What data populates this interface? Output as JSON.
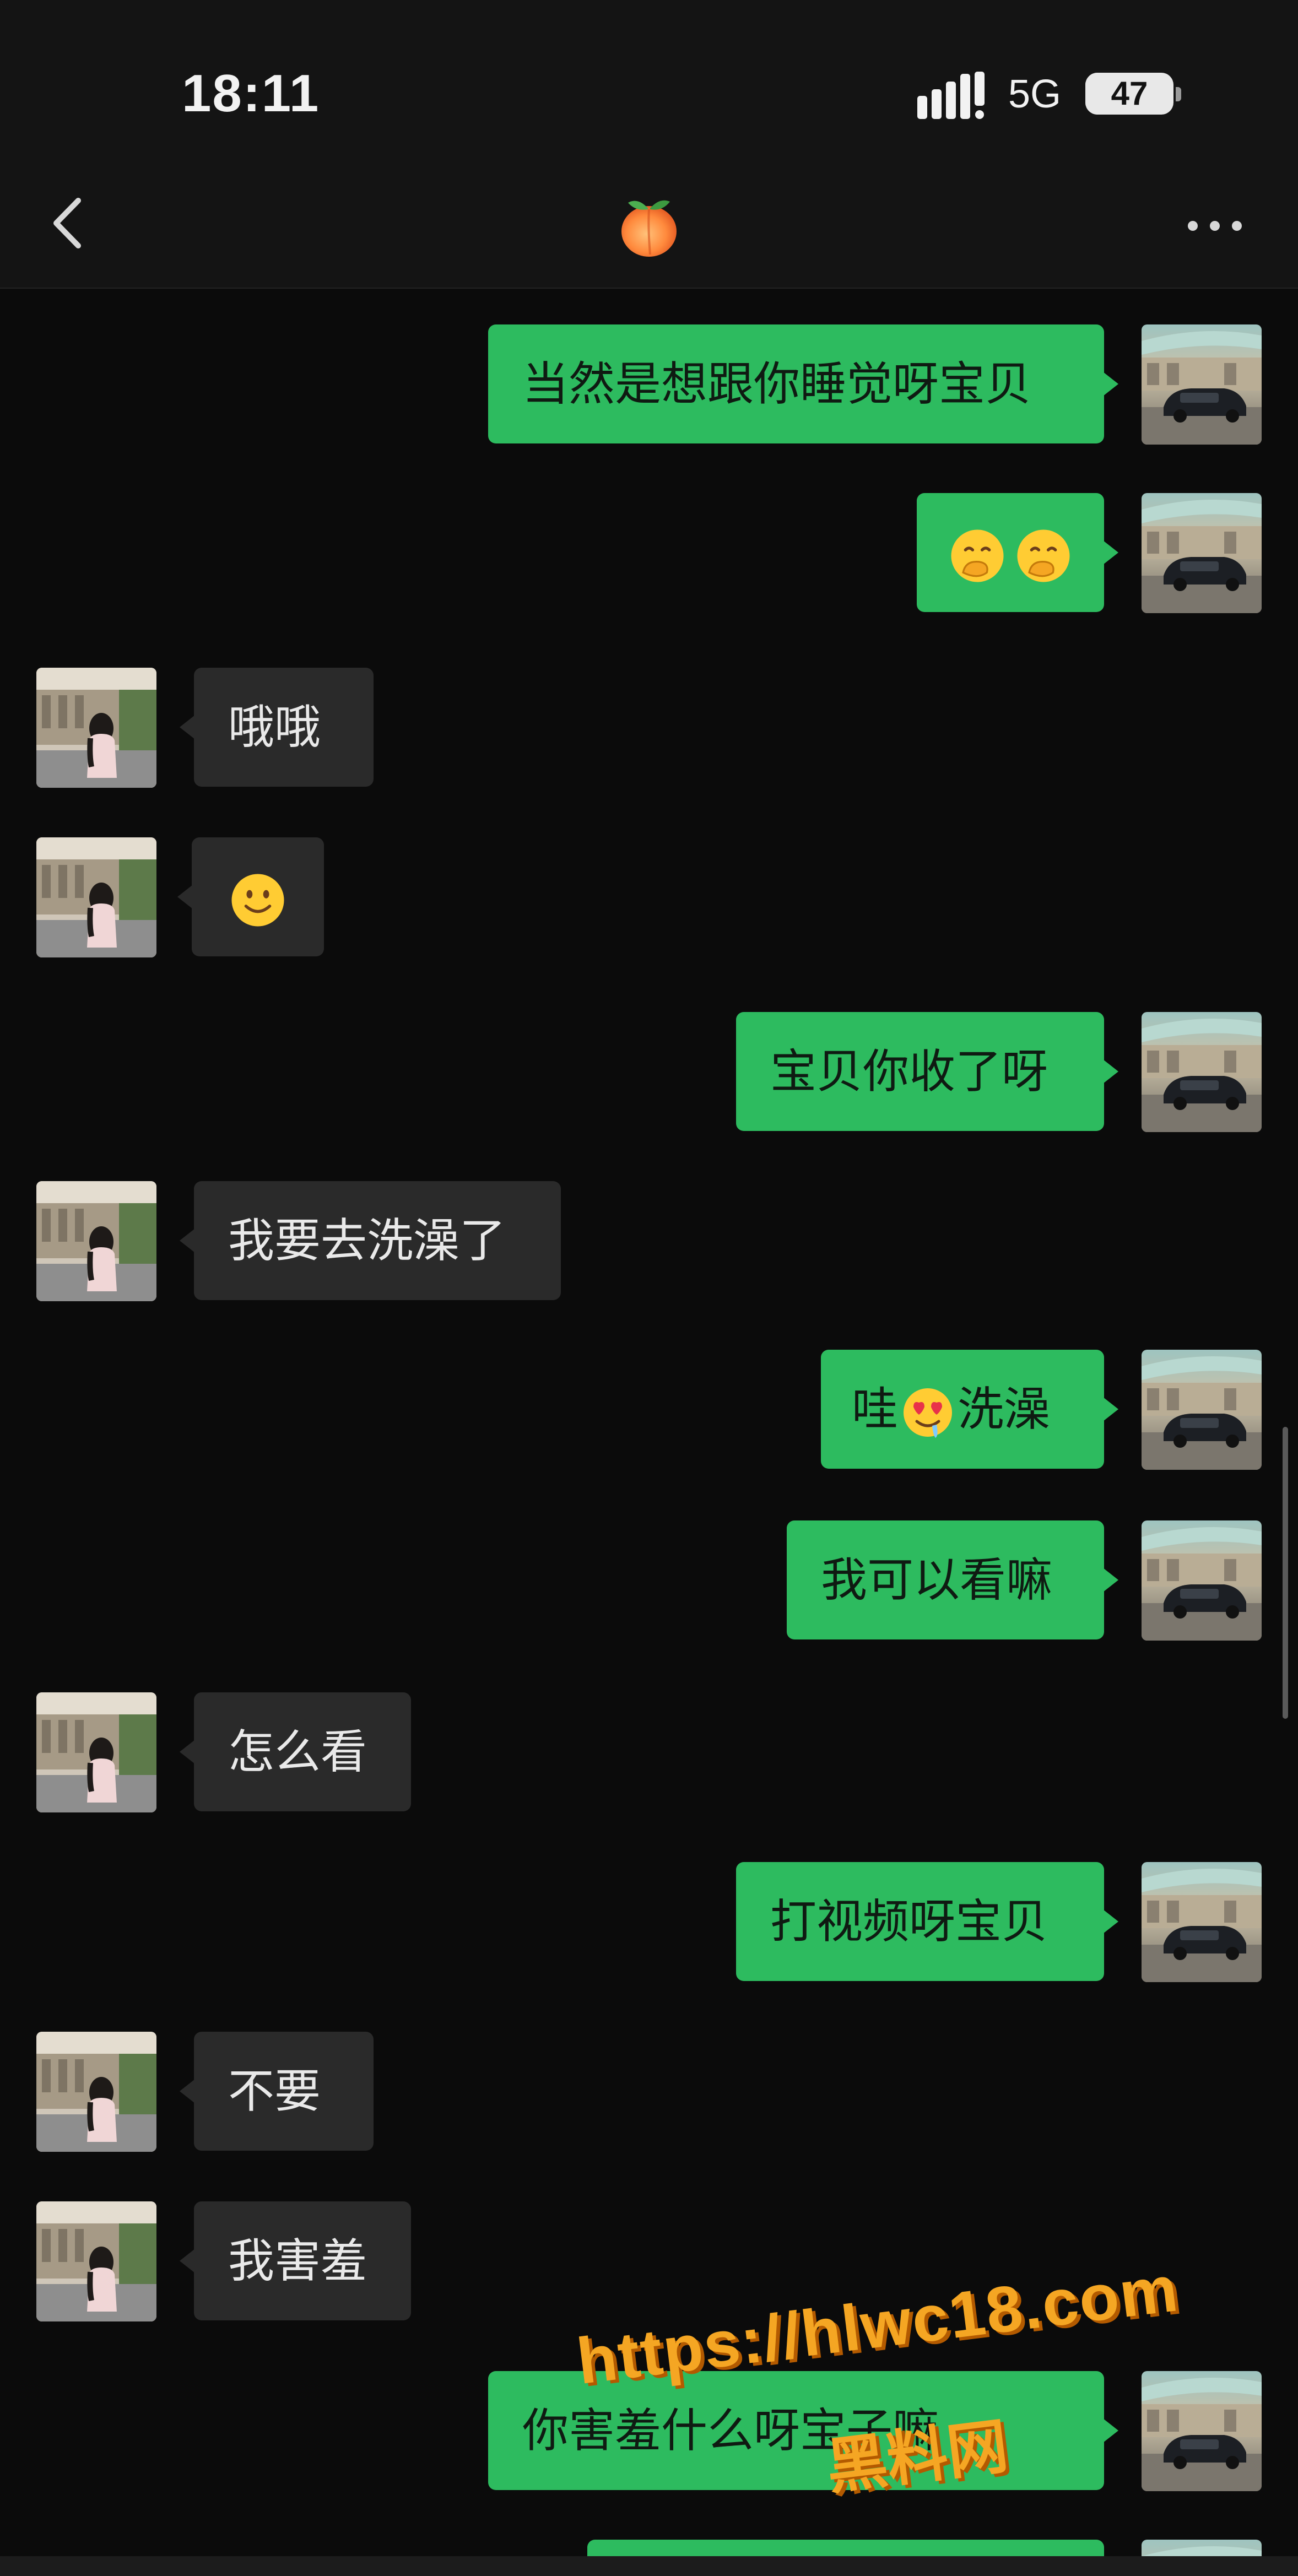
{
  "status_bar": {
    "time": "18:11",
    "network": "5G",
    "battery": "47",
    "battery_level": 0.47
  },
  "header": {
    "title_icon": "peach-icon",
    "back_icon": "chevron-left-icon",
    "more_icon": "more-dots-icon"
  },
  "messages": [
    {
      "side": "out",
      "text": "当然是想跟你睡觉呀宝贝"
    },
    {
      "side": "out",
      "text": "",
      "emojis": [
        "hand-over-mouth-emoji",
        "hand-over-mouth-emoji"
      ]
    },
    {
      "side": "in",
      "text": "哦哦"
    },
    {
      "side": "in",
      "text": "",
      "emojis": [
        "slight-smile-emoji"
      ]
    },
    {
      "side": "out",
      "text": "宝贝你收了呀"
    },
    {
      "side": "in",
      "text": "我要去洗澡了"
    },
    {
      "side": "out",
      "text_before": "哇",
      "emoji": "heart-eyes-drool-emoji",
      "text_after": "洗澡"
    },
    {
      "side": "out",
      "text": "我可以看嘛"
    },
    {
      "side": "in",
      "text": "怎么看"
    },
    {
      "side": "out",
      "text": "打视频呀宝贝"
    },
    {
      "side": "in",
      "text": "不要"
    },
    {
      "side": "in",
      "text": "我害羞"
    },
    {
      "side": "out",
      "text": "你害羞什么呀宝子嘛"
    }
  ],
  "watermark": {
    "url": "https://hlwc18.com",
    "name": "黑料网"
  },
  "colors": {
    "outgoing_bubble": "#2dbb5f",
    "incoming_bubble": "#2a2a2a",
    "background": "#0b0b0b"
  }
}
